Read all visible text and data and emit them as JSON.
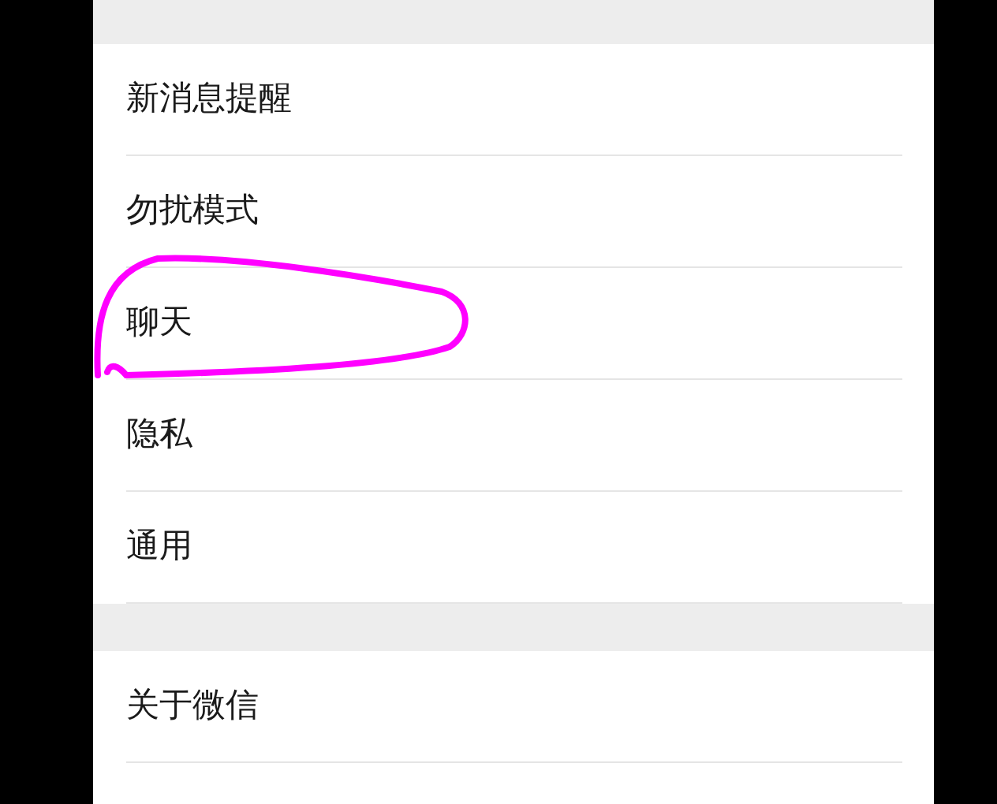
{
  "groups": [
    {
      "items": [
        {
          "label": "新消息提醒"
        },
        {
          "label": "勿扰模式"
        },
        {
          "label": "聊天"
        },
        {
          "label": "隐私"
        },
        {
          "label": "通用"
        }
      ]
    },
    {
      "items": [
        {
          "label": "关于微信"
        }
      ]
    }
  ]
}
